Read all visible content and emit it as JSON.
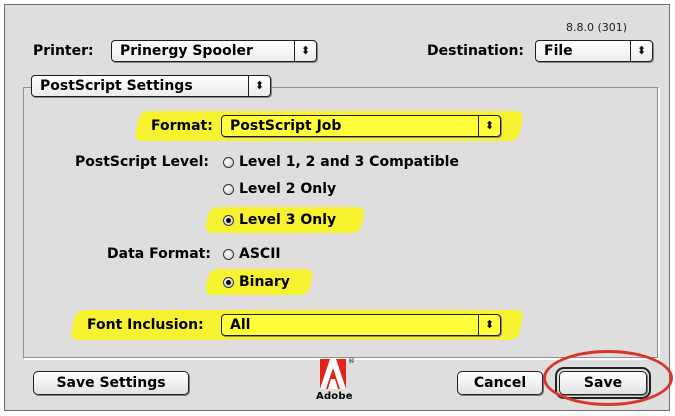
{
  "dialog": {
    "version": "8.8.0 (301)",
    "printer": {
      "label": "Printer:",
      "value": "Prinergy Spooler"
    },
    "destination": {
      "label": "Destination:",
      "value": "File"
    },
    "panel_popup": "PostScript Settings",
    "format": {
      "label": "Format:",
      "value": "PostScript Job"
    },
    "postscript_level": {
      "label": "PostScript Level:",
      "options": [
        "Level 1, 2 and 3 Compatible",
        "Level 2 Only",
        "Level 3 Only"
      ],
      "selected": "Level 3 Only"
    },
    "data_format": {
      "label": "Data Format:",
      "options": [
        "ASCII",
        "Binary"
      ],
      "selected": "Binary"
    },
    "font_inclusion": {
      "label": "Font Inclusion:",
      "value": "All"
    },
    "buttons": {
      "save_settings": "Save Settings",
      "cancel": "Cancel",
      "save": "Save"
    },
    "logo_text": "Adobe",
    "logo_reg": "®",
    "popup_arrow": "⬍",
    "colors": {
      "highlight": "#f7f230",
      "annotation_circle": "#d9362b",
      "dialog_bg": "#dedede"
    }
  }
}
